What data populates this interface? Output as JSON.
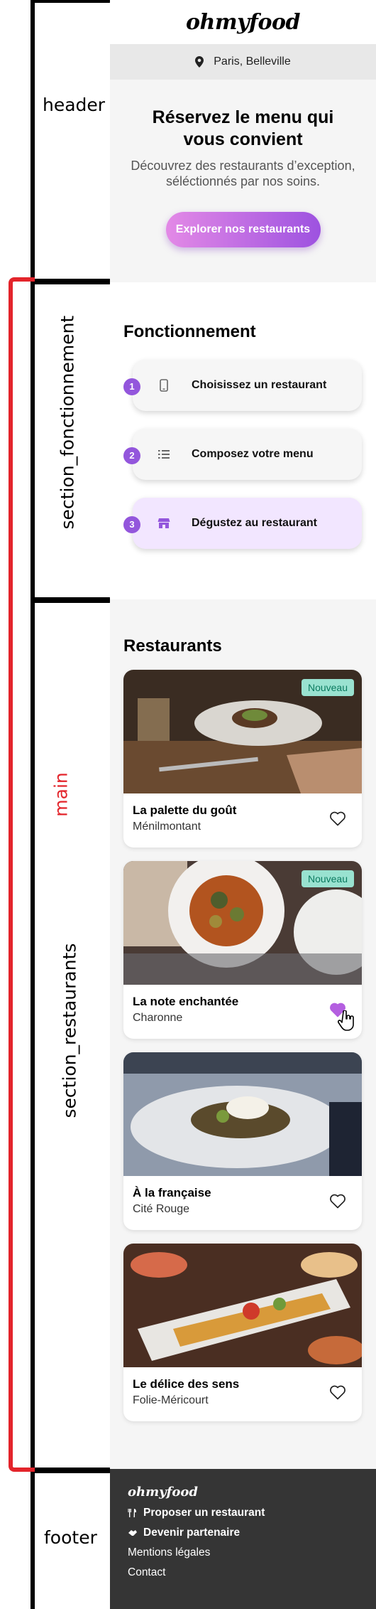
{
  "annotations": {
    "header": "header",
    "section_fonctionnement": "section_fonctionnement",
    "main": "main",
    "section_restaurants": "section_restaurants",
    "footer": "footer"
  },
  "site": {
    "logo": "ohmyfood",
    "location": "Paris, Belleville",
    "hero": {
      "title": "Réservez le menu qui vous convient",
      "subtitle": "Découvrez des restaurants d’exception, séléctionnés par nos soins.",
      "cta": "Explorer nos restaurants"
    },
    "how": {
      "title": "Fonctionnement",
      "steps": [
        {
          "num": "1",
          "label": "Choisissez un restaurant",
          "icon": "phone-icon"
        },
        {
          "num": "2",
          "label": "Composez votre menu",
          "icon": "list-icon"
        },
        {
          "num": "3",
          "label": "Dégustez au restaurant",
          "icon": "store-icon"
        }
      ]
    },
    "restaurants": {
      "title": "Restaurants",
      "items": [
        {
          "name": "La palette du goût",
          "area": "Ménilmontant",
          "badge": "Nouveau",
          "liked": false
        },
        {
          "name": "La note enchantée",
          "area": "Charonne",
          "badge": "Nouveau",
          "liked": true
        },
        {
          "name": "À la française",
          "area": "Cité Rouge",
          "badge": "",
          "liked": false
        },
        {
          "name": "Le délice des sens",
          "area": "Folie-Méricourt",
          "badge": "",
          "liked": false
        }
      ]
    },
    "footer": {
      "logo": "ohmyfood",
      "links": [
        "Proposer un restaurant",
        "Devenir partenaire",
        "Mentions légales",
        "Contact"
      ]
    }
  },
  "colors": {
    "accent": "#9356dc",
    "annotation_red": "#e3242b",
    "badge_bg": "#99e2d0"
  }
}
